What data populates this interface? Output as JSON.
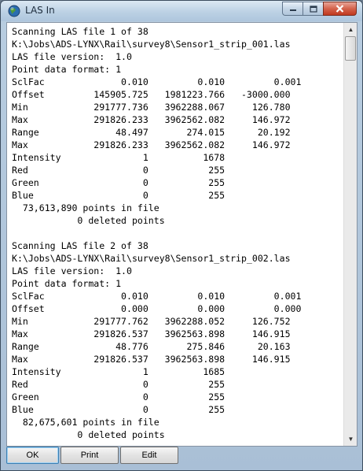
{
  "window": {
    "title": "LAS In",
    "app_icon": "globe-icon",
    "controls": {
      "minimize": "minimize-icon",
      "maximize": "maximize-icon",
      "close": "close-icon"
    }
  },
  "output_lines": [
    "Scanning LAS file 1 of 38",
    "K:\\Jobs\\ADS-LYNX\\Rail\\survey8\\Sensor1_strip_001.las",
    "LAS file version:  1.0",
    "Point data format: 1",
    "SclFac              0.010         0.010         0.001",
    "Offset         145905.725   1981223.766   -3000.000",
    "Min            291777.736   3962288.067     126.780",
    "Max            291826.233   3962562.082     146.972",
    "Range              48.497       274.015      20.192",
    "Max            291826.233   3962562.082     146.972",
    "Intensity               1          1678",
    "Red                     0           255",
    "Green                   0           255",
    "Blue                    0           255",
    "  73,613,890 points in file",
    "            0 deleted points",
    "",
    "Scanning LAS file 2 of 38",
    "K:\\Jobs\\ADS-LYNX\\Rail\\survey8\\Sensor1_strip_002.las",
    "LAS file version:  1.0",
    "Point data format: 1",
    "SclFac              0.010         0.010         0.001",
    "Offset              0.000         0.000         0.000",
    "Min            291777.762   3962288.052     126.752",
    "Max            291826.537   3962563.898     146.915",
    "Range              48.776       275.846      20.163",
    "Max            291826.537   3962563.898     146.915",
    "Intensity               1          1685",
    "Red                     0           255",
    "Green                   0           255",
    "Blue                    0           255",
    "  82,675,601 points in file",
    "            0 deleted points"
  ],
  "buttons": {
    "ok": "OK",
    "print": "Print",
    "edit": "Edit"
  }
}
